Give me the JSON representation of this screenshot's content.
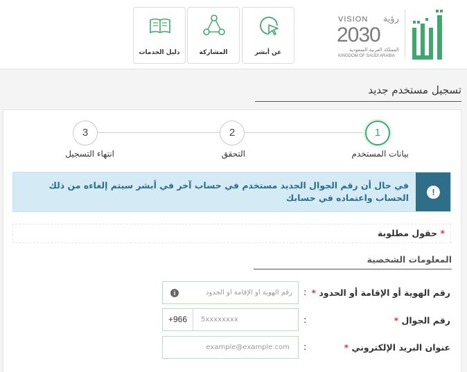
{
  "header": {
    "tiles": [
      {
        "label": "دليل الخدمات",
        "icon": "book-icon"
      },
      {
        "label": "المشاركة",
        "icon": "share-icon"
      },
      {
        "label": "عن أبشر",
        "icon": "cursor-click-icon"
      }
    ],
    "vision": {
      "top": "VISION",
      "arabic": "رؤية",
      "number": "2030",
      "kingdom_ar": "المملكة العربية السعودية",
      "kingdom_en": "KINGDOM OF SAUDI ARABIA"
    },
    "logo": "absher-logo"
  },
  "page_title": "تسجيل مستخدم جديد",
  "stepper": {
    "steps": [
      {
        "number": "1",
        "label": "بيانات المستخدم",
        "active": true
      },
      {
        "number": "2",
        "label": "التحقق",
        "active": false
      },
      {
        "number": "3",
        "label": "انتهاء التسجيل",
        "active": false
      }
    ]
  },
  "alert": {
    "icon": "exclamation-icon",
    "text": "في حال أن رقم الجوال الجديد مستخدم في حساب آخر في أبشر سيتم إلغاءه من ذلك الحساب واعتماده في حسابك"
  },
  "required_note": {
    "star": "*",
    "text": "حقول مطلوبة"
  },
  "section_title": "المعلومات الشخصية",
  "form": {
    "id_field": {
      "label": "رقم الهوية أو الإقامة أو الحدود",
      "star": "*",
      "colon": ":",
      "placeholder": "رقم الهوية أو الإقامة أو الحدود",
      "value": ""
    },
    "mobile_field": {
      "label": "رقم الجوال",
      "star": "*",
      "colon": ":",
      "country_code": "+966",
      "placeholder": "5xxxxxxxx",
      "value": ""
    },
    "email_field": {
      "label": "عنوان البريد الإلكتروني",
      "star": "*",
      "colon": ":",
      "placeholder": "example@example.com",
      "value": ""
    }
  },
  "colors": {
    "brand_green": "#3fa96d",
    "alert_bg": "#d4ebf6",
    "alert_dark": "#2e6e88",
    "required_red": "#e0364b"
  }
}
